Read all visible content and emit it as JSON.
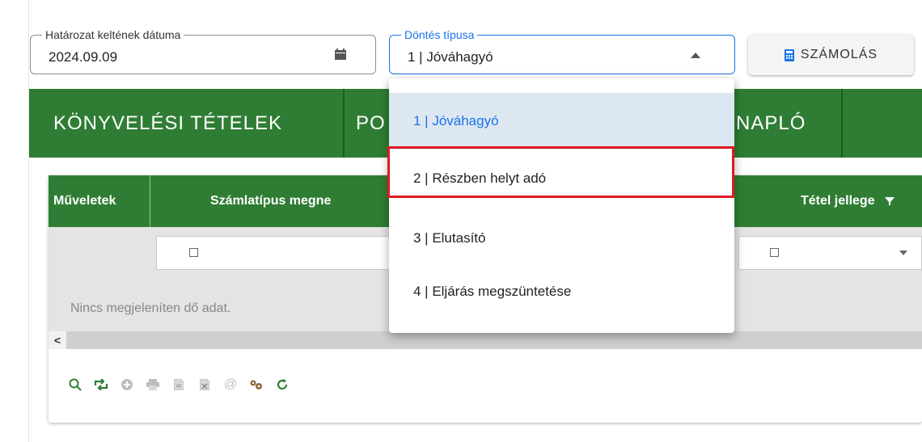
{
  "date_field": {
    "legend": "Határozat keltének dátuma",
    "value": "2024.09.09",
    "icon": "calendar-icon"
  },
  "decision_field": {
    "legend": "Döntés típusa",
    "value": "1 | Jóváhagyó",
    "icon": "caret-up-icon"
  },
  "calc_button": {
    "label": "SZÁMOLÁS",
    "icon": "calculator-icon"
  },
  "tabs": [
    {
      "label": "KÖNYVELÉSI TÉTELEK"
    },
    {
      "label": "PO"
    },
    {
      "label": "NAPLÓ"
    }
  ],
  "grid": {
    "columns": [
      {
        "label": "Műveletek"
      },
      {
        "label": "Számlatípus megne"
      },
      {
        "label": "Tétel jellege"
      }
    ],
    "empty_text": "Nincs megjeleníten dő adat.",
    "scroll_left": "<"
  },
  "toolbar": {
    "icons": [
      "search-icon",
      "swap-icon",
      "add-icon",
      "print-icon",
      "document-icon",
      "excel-icon",
      "email-icon",
      "settings-icon",
      "refresh-icon"
    ]
  },
  "dropdown": {
    "options": [
      {
        "label": "1 | Jóváhagyó",
        "selected": true
      },
      {
        "label": "2 | Részben helyt adó",
        "highlighted": true
      },
      {
        "label": "3 | Elutasító"
      },
      {
        "label": "4 | Eljárás megszüntetése"
      }
    ]
  },
  "colors": {
    "green": "#2f7d34",
    "blue": "#1a73e8",
    "highlight_red": "#e01b24"
  }
}
